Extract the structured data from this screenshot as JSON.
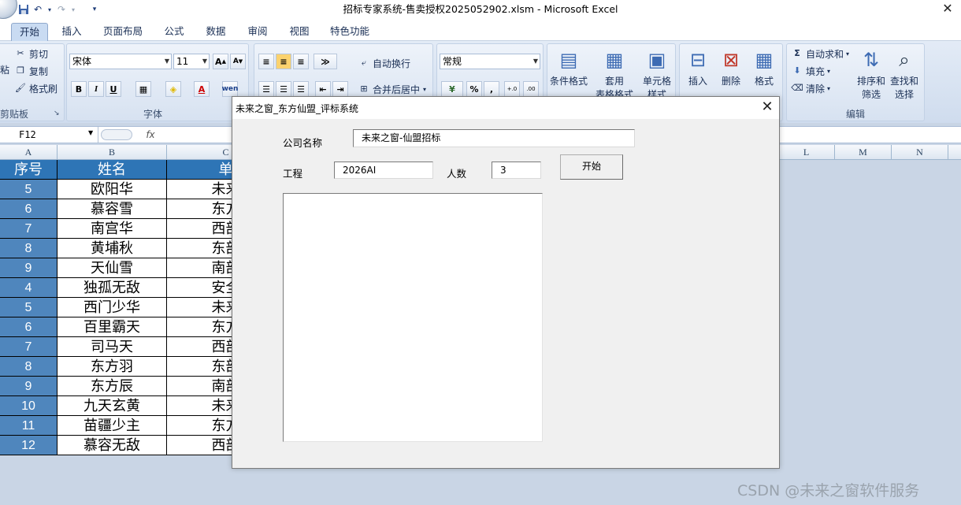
{
  "window": {
    "title": "招标专家系统-售卖授权2025052902.xlsm - Microsoft Excel"
  },
  "quick_access": [
    "save-icon",
    "undo-icon",
    "redo-icon",
    "customize-icon"
  ],
  "ribbon": {
    "tabs": [
      "开始",
      "插入",
      "页面布局",
      "公式",
      "数据",
      "审阅",
      "视图",
      "特色功能"
    ],
    "clipboard": {
      "cut": "剪切",
      "copy": "复制",
      "format_painter": "格式刷",
      "label": "剪贴板",
      "paste_partial": "粘"
    },
    "font": {
      "name": "宋体",
      "size": "11",
      "bold": "B",
      "italic": "I",
      "underline": "U",
      "font_color_glyph": "A",
      "label": "字体"
    },
    "alignment": {
      "wrap": "自动换行",
      "merge": "合并后居中"
    },
    "number": {
      "format": "常规",
      "percent": "%",
      "comma": ","
    },
    "styles": {
      "conditional": "条件格式",
      "table_format": "套用",
      "table_format_2": "表格格式",
      "cell_styles": "单元格",
      "cell_styles_2": "样式"
    },
    "cells": {
      "insert": "插入",
      "delete": "删除",
      "format": "格式"
    },
    "editing": {
      "autosum": "自动求和",
      "fill": "填充",
      "clear": "清除",
      "sort": "排序和",
      "sort_2": "筛选",
      "find": "查找和",
      "find_2": "选择",
      "label": "编辑"
    }
  },
  "formula_bar": {
    "name_box": "F12",
    "fx": "fx"
  },
  "sheet": {
    "columns": [
      "A",
      "B",
      "C",
      "L",
      "M",
      "N"
    ],
    "header_row": {
      "a": "序号",
      "b": "姓名",
      "c": "单"
    },
    "rows": [
      {
        "a": "5",
        "b": "欧阳华",
        "c": "未来"
      },
      {
        "a": "6",
        "b": "慕容雪",
        "c": "东方"
      },
      {
        "a": "7",
        "b": "南宫华",
        "c": "西部"
      },
      {
        "a": "8",
        "b": "黄埔秋",
        "c": "东部"
      },
      {
        "a": "9",
        "b": "天仙雪",
        "c": "南部"
      },
      {
        "a": "4",
        "b": "独孤无敌",
        "c": "安全"
      },
      {
        "a": "5",
        "b": "西门少华",
        "c": "未来"
      },
      {
        "a": "6",
        "b": "百里霸天",
        "c": "东方"
      },
      {
        "a": "7",
        "b": "司马天",
        "c": "西部"
      },
      {
        "a": "8",
        "b": "东方羽",
        "c": "东部"
      },
      {
        "a": "9",
        "b": "东方辰",
        "c": "南部"
      },
      {
        "a": "10",
        "b": "九天玄黄",
        "c": "未来"
      },
      {
        "a": "11",
        "b": "苗疆少主",
        "c": "东方"
      },
      {
        "a": "12",
        "b": "慕容无敌",
        "c": "西部"
      }
    ]
  },
  "dialog": {
    "title": "未来之窗_东方仙盟_评标系统",
    "company_label": "公司名称",
    "company_value": "未来之窗-仙盟招标",
    "project_label": "工程",
    "project_value": "2026AI",
    "count_label": "人数",
    "count_value": "3",
    "start_button": "开始"
  },
  "watermark": "CSDN @未来之窗软件服务"
}
